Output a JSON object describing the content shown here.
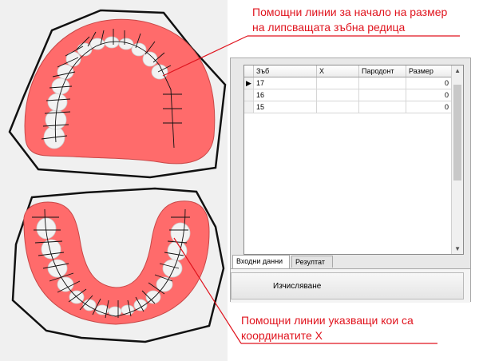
{
  "annotations": {
    "top_line1": "Помощни линии за начало на размер",
    "top_line2": "на липсващата зъбна редица",
    "bottom_line1": "Помощни линии указващи кои са",
    "bottom_line2": "координатите Х"
  },
  "grid": {
    "columns": [
      "Зъб",
      "X",
      "Пародонт",
      "Размер"
    ],
    "rows": [
      {
        "tooth": "17",
        "x": "",
        "periodont": "",
        "size": "0",
        "current": true
      },
      {
        "tooth": "16",
        "x": "",
        "periodont": "",
        "size": "0",
        "current": false
      },
      {
        "tooth": "15",
        "x": "",
        "periodont": "",
        "size": "0",
        "current": false
      }
    ]
  },
  "tabs": [
    "Входни данни",
    "Резултат"
  ],
  "active_tab": "Входни данни",
  "calc_button_label": "Изчисляване",
  "colors": {
    "gum": "#ff6b6b",
    "annotation": "#e0141e",
    "tooth": "#f2f2f2",
    "gum_edge": "#c94848"
  }
}
